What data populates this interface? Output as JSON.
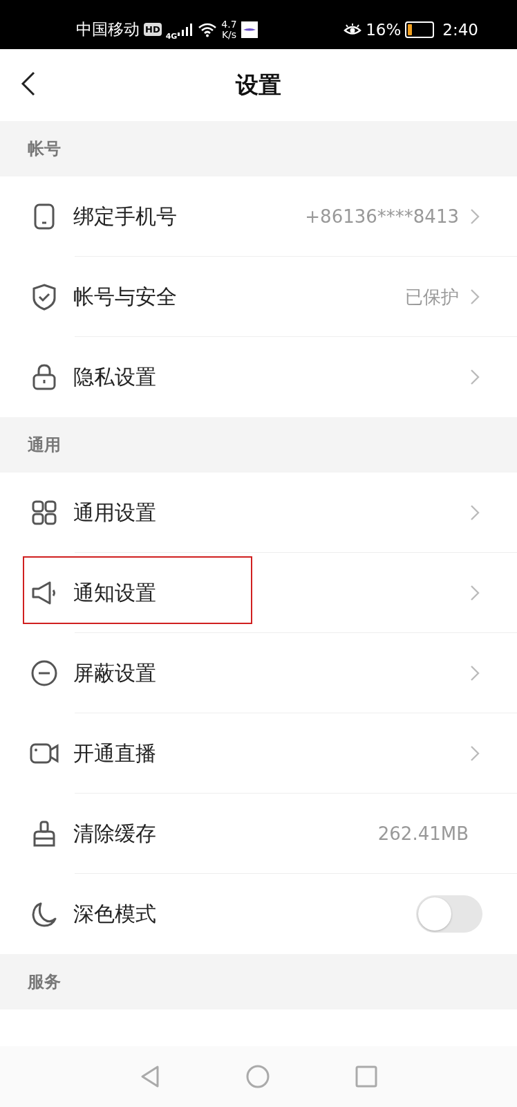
{
  "status_bar": {
    "carrier": "中国移动",
    "network_badge": "HD",
    "network_type": "4G",
    "speed_value": "4.7",
    "speed_unit": "K/s",
    "battery_percent": "16%",
    "battery": {
      "level": 0.16
    },
    "time": "2:40"
  },
  "header": {
    "title": "设置"
  },
  "sections": [
    {
      "title": "帐号",
      "rows": [
        {
          "kind": "link",
          "label": "绑定手机号",
          "value": "+86136****8413",
          "highlighted": false
        },
        {
          "kind": "link",
          "label": "帐号与安全",
          "value": "已保护",
          "highlighted": false
        },
        {
          "kind": "link",
          "label": "隐私设置",
          "highlighted": false
        }
      ]
    },
    {
      "title": "通用",
      "rows": [
        {
          "kind": "link",
          "label": "通用设置",
          "highlighted": false
        },
        {
          "kind": "link",
          "label": "通知设置",
          "highlighted": true
        },
        {
          "kind": "link",
          "label": "屏蔽设置",
          "highlighted": false
        },
        {
          "kind": "link",
          "label": "开通直播",
          "highlighted": false
        },
        {
          "kind": "value",
          "label": "清除缓存",
          "value": "262.41MB",
          "highlighted": false
        },
        {
          "kind": "toggle",
          "label": "深色模式",
          "on": false,
          "highlighted": false
        }
      ]
    },
    {
      "title": "服务"
    }
  ]
}
